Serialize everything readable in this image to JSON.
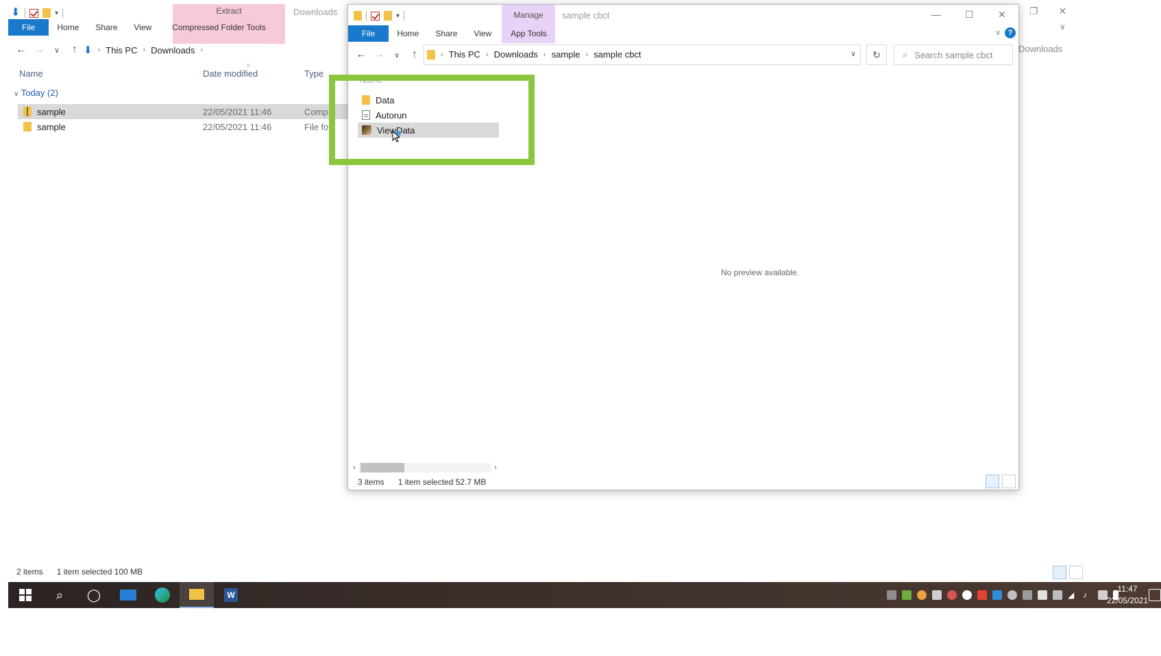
{
  "back": {
    "title": "Downloads",
    "context_tab": "Extract",
    "tabs": [
      "File",
      "Home",
      "Share",
      "View",
      "Compressed Folder Tools"
    ],
    "breadcrumb": [
      "This PC",
      "Downloads"
    ],
    "search_partial": "Downloads",
    "columns": [
      "Name",
      "Date modified",
      "Type"
    ],
    "group": "Today (2)",
    "files": [
      {
        "name": "sample",
        "date": "22/05/2021 11:46",
        "type": "Comp"
      },
      {
        "name": "sample",
        "date": "22/05/2021 11:46",
        "type": "File fo"
      }
    ],
    "status": {
      "items": "2 items",
      "selected": "1 item selected  100 MB"
    }
  },
  "front": {
    "title": "sample cbct",
    "context_tab": "Manage",
    "tabs": [
      "File",
      "Home",
      "Share",
      "View",
      "App Tools"
    ],
    "breadcrumb": [
      "This PC",
      "Downloads",
      "sample",
      "sample cbct"
    ],
    "search_placeholder": "Search sample cbct",
    "column": "Name",
    "items": [
      {
        "name": "Data",
        "icon": "folder-icon"
      },
      {
        "name": "Autorun",
        "icon": "settings-file-icon"
      },
      {
        "name": "ViewData",
        "icon": "application-icon",
        "selected": true
      }
    ],
    "preview": "No preview available.",
    "status": {
      "items": "3 items",
      "selected": "1 item selected  52.7 MB"
    }
  },
  "taskbar": {
    "time": "11:47",
    "date": "22/05/2021"
  },
  "colors": {
    "highlight_box": "#8cc63f",
    "file_tab": "#1979ca",
    "extract_tab": "#f7c9d9",
    "manage_tab": "#e8d2f7",
    "selection": "#d9d9d9"
  }
}
